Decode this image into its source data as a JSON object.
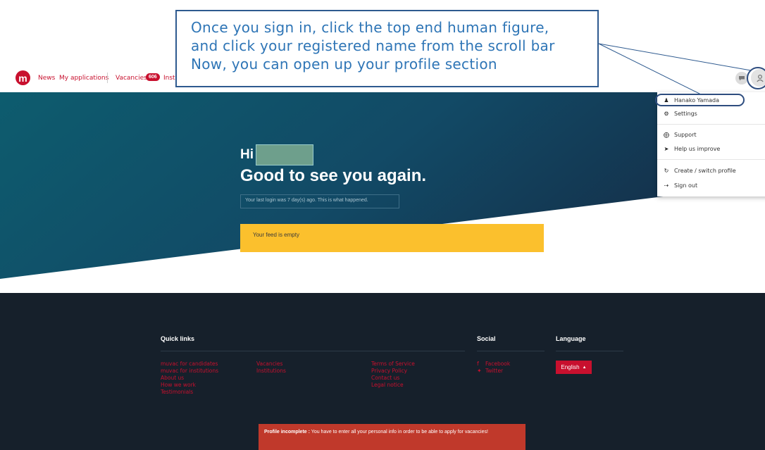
{
  "nav": {
    "logo_letter": "m",
    "items": [
      "News",
      "My applications",
      "Vacancies",
      "Inst"
    ],
    "vacancies_badge": "606"
  },
  "callout": {
    "lines": [
      "Once you sign in, click the top end human figure,",
      "and click your registered name from the scroll bar",
      "Now, you can open up your profile section"
    ]
  },
  "hero": {
    "greeting": "Hi",
    "welcome": "Good to see you again.",
    "last_login": "Your last login was 7 day(s) ago. This is what happened.",
    "feed_status": "Your feed is empty"
  },
  "user_menu": {
    "items": [
      {
        "label": "Hanako Yamada",
        "icon": "person-icon"
      },
      {
        "label": "Settings",
        "icon": "gear-icon"
      },
      {
        "label": "Support",
        "icon": "lifebuoy-icon"
      },
      {
        "label": "Help us improve",
        "icon": "rocket-icon"
      },
      {
        "label": "Create / switch profile",
        "icon": "refresh-icon"
      },
      {
        "label": "Sign out",
        "icon": "sign-out-icon"
      }
    ]
  },
  "footer": {
    "quick_links_title": "Quick links",
    "quick_links_col1": [
      "muvac for candidates",
      "muvac for institutions",
      "About us",
      "How we work",
      "Testimonials"
    ],
    "quick_links_col2": [
      "Vacancies",
      "Institutions"
    ],
    "quick_links_col3": [
      "Terms of Service",
      "Privacy Policy",
      "Contact us",
      "Legal notice"
    ],
    "social_title": "Social",
    "social_links": [
      "Facebook",
      "Twitter"
    ],
    "language_title": "Language",
    "language_selected": "English"
  },
  "alert": {
    "bold": "Profile incomplete :",
    "text": " You have to enter all your personal info in order to be able to apply for vacancies!"
  },
  "colors": {
    "brand_red": "#c8102e",
    "hero_teal": "#0d5c6e",
    "hero_navy": "#14304a",
    "feed_yellow": "#fbc02d",
    "footer_bg": "#16202b",
    "callout_blue": "#2e75b6"
  }
}
